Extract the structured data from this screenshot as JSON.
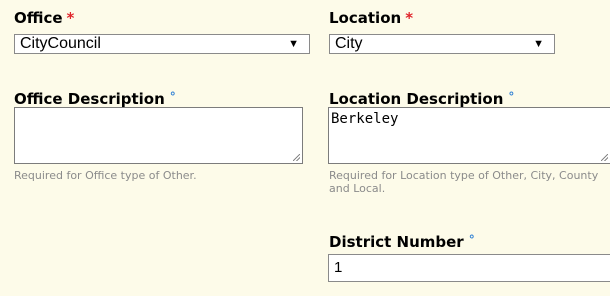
{
  "office": {
    "label": "Office",
    "required_marker": "*",
    "selected": "CityCouncil",
    "arrow": "▼"
  },
  "location": {
    "label": "Location",
    "required_marker": "*",
    "selected": "City",
    "arrow": "▼"
  },
  "office_description": {
    "label": "Office Description",
    "marker": "°",
    "value": "",
    "help": "Required for Office type of Other."
  },
  "location_description": {
    "label": "Location Description",
    "marker": "°",
    "value": "Berkeley",
    "help": "Required for Location type of Other, City, County and Local."
  },
  "district_number": {
    "label": "District Number",
    "marker": "°",
    "value": "1"
  },
  "colors": {
    "background": "#fdfbe9",
    "required_marker": "#e0242b",
    "optional_marker": "#2e7fd4",
    "help_text": "#8b8b8b"
  }
}
